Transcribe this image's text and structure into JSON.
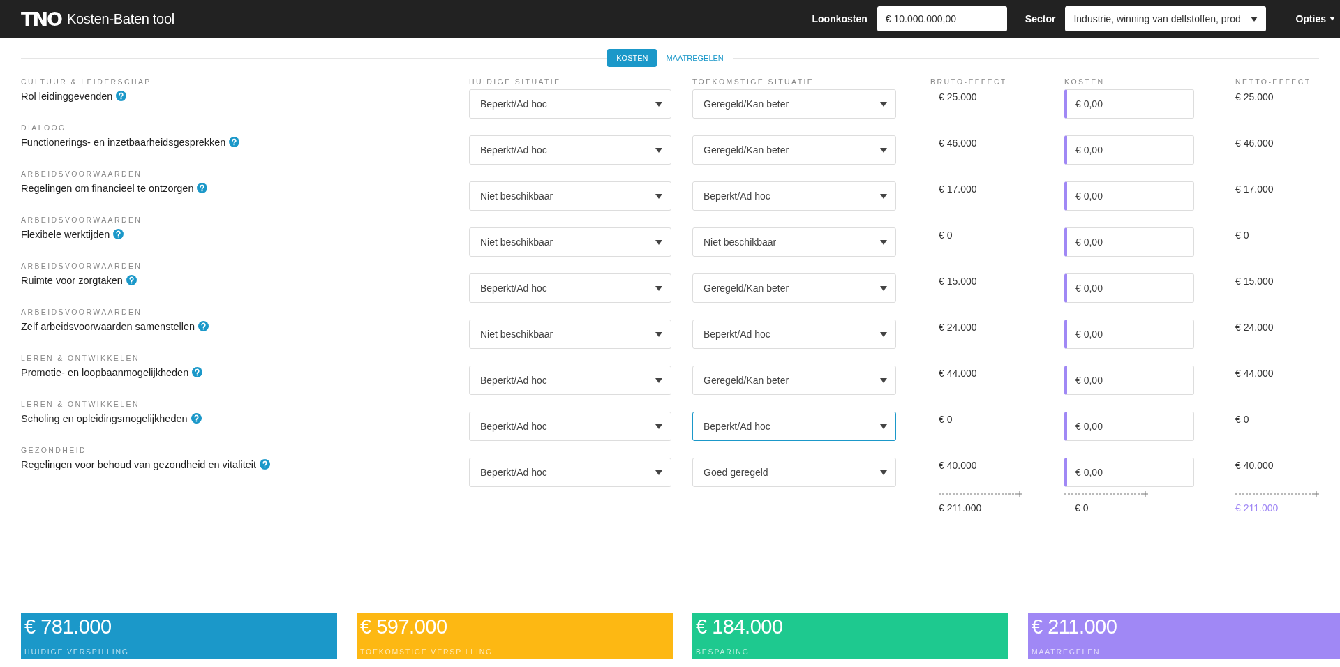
{
  "header": {
    "logo": "TNO",
    "title": "Kosten-Baten tool",
    "loonkosten": {
      "label": "Loonkosten",
      "value": "€ 10.000.000,00"
    },
    "sector": {
      "label": "Sector",
      "value": "Industrie, winning van delfstoffen, prod"
    },
    "options": "Opties"
  },
  "tabs": [
    {
      "label": "KOSTEN",
      "selected": true
    },
    {
      "label": "MAATREGELEN",
      "selected": false
    }
  ],
  "columns": {
    "current": "HUIDIGE SITUATIE",
    "future": "TOEKOMSTIGE SITUATIE",
    "gross": "BRUTO-EFFECT",
    "costs": "KOSTEN",
    "net": "NETTO-EFFECT"
  },
  "rows": [
    {
      "category": "CULTUUR & LEIDERSCHAP",
      "title": "Rol leidinggevenden",
      "current": "Beperkt/Ad hoc",
      "future": "Geregeld/Kan beter",
      "future_focused": false,
      "gross": "€ 25.000",
      "costs": "€ 0,00",
      "net": "€ 25.000"
    },
    {
      "category": "DIALOOG",
      "title": "Functionerings- en inzetbaarheidsgesprekken",
      "current": "Beperkt/Ad hoc",
      "future": "Geregeld/Kan beter",
      "future_focused": false,
      "gross": "€ 46.000",
      "costs": "€ 0,00",
      "net": "€ 46.000"
    },
    {
      "category": "ARBEIDSVOORWAARDEN",
      "title": "Regelingen om financieel te ontzorgen",
      "current": "Niet beschikbaar",
      "future": "Beperkt/Ad hoc",
      "future_focused": false,
      "gross": "€ 17.000",
      "costs": "€ 0,00",
      "net": "€ 17.000"
    },
    {
      "category": "ARBEIDSVOORWAARDEN",
      "title": "Flexibele werktijden",
      "current": "Niet beschikbaar",
      "future": "Niet beschikbaar",
      "future_focused": false,
      "gross": "€ 0",
      "costs": "€ 0,00",
      "net": "€ 0"
    },
    {
      "category": "ARBEIDSVOORWAARDEN",
      "title": "Ruimte voor zorgtaken",
      "current": "Beperkt/Ad hoc",
      "future": "Geregeld/Kan beter",
      "future_focused": false,
      "gross": "€ 15.000",
      "costs": "€ 0,00",
      "net": "€ 15.000"
    },
    {
      "category": "ARBEIDSVOORWAARDEN",
      "title": "Zelf arbeidsvoorwaarden samenstellen",
      "current": "Niet beschikbaar",
      "future": "Beperkt/Ad hoc",
      "future_focused": false,
      "gross": "€ 24.000",
      "costs": "€ 0,00",
      "net": "€ 24.000"
    },
    {
      "category": "LEREN & ONTWIKKELEN",
      "title": "Promotie- en loopbaanmogelijkheden",
      "current": "Beperkt/Ad hoc",
      "future": "Geregeld/Kan beter",
      "future_focused": false,
      "gross": "€ 44.000",
      "costs": "€ 0,00",
      "net": "€ 44.000"
    },
    {
      "category": "LEREN & ONTWIKKELEN",
      "title": "Scholing en opleidingsmogelijkheden",
      "current": "Beperkt/Ad hoc",
      "future": "Beperkt/Ad hoc",
      "future_focused": true,
      "gross": "€ 0",
      "costs": "€ 0,00",
      "net": "€ 0"
    },
    {
      "category": "GEZONDHEID",
      "title": "Regelingen voor behoud van gezondheid en vitaliteit",
      "current": "Beperkt/Ad hoc",
      "future": "Goed geregeld",
      "future_focused": false,
      "gross": "€ 40.000",
      "costs": "€ 0,00",
      "net": "€ 40.000"
    }
  ],
  "totals": {
    "gross": "€ 211.000",
    "costs": "€ 0",
    "net": "€ 211.000"
  },
  "cards": [
    {
      "value": "€ 781.000",
      "label": "HUIDIGE VERSPILLING",
      "color": "#1b98c9"
    },
    {
      "value": "€ 597.000",
      "label": "TOEKOMSTIGE VERSPILLING",
      "color": "#fdb813"
    },
    {
      "value": "€ 184.000",
      "label": "BESPARING",
      "color": "#1ec98f"
    },
    {
      "value": "€ 211.000",
      "label": "MAATREGELEN",
      "color": "#a088f5"
    }
  ]
}
